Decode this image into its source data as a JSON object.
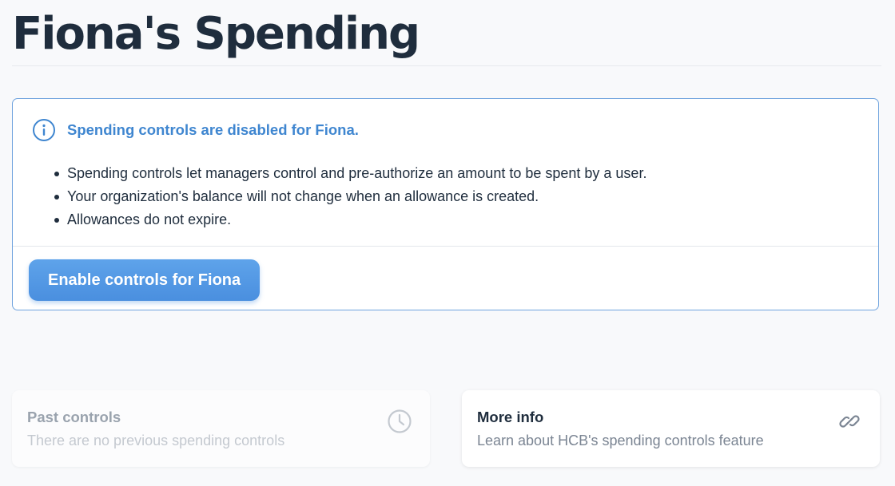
{
  "page": {
    "title": "Fiona's Spending"
  },
  "notice": {
    "icon": "info-icon",
    "heading": "Spending controls are disabled for Fiona.",
    "bullets": [
      "Spending controls let managers control and pre-authorize an amount to be spent by a user.",
      "Your organization's balance will not change when an allowance is created.",
      "Allowances do not expire."
    ],
    "button_label": "Enable controls for Fiona"
  },
  "cards": {
    "past": {
      "title": "Past controls",
      "subtitle": "There are no previous spending controls",
      "icon": "clock-icon"
    },
    "info": {
      "title": "More info",
      "subtitle": "Learn about HCB's spending controls feature",
      "icon": "link-icon"
    }
  },
  "colors": {
    "accent": "#3f86d0",
    "border": "#6fa3de",
    "button": "#4a8fdf",
    "text": "#1f2d3d",
    "muted": "#7b8593",
    "disabled": "#c4c9d0"
  }
}
